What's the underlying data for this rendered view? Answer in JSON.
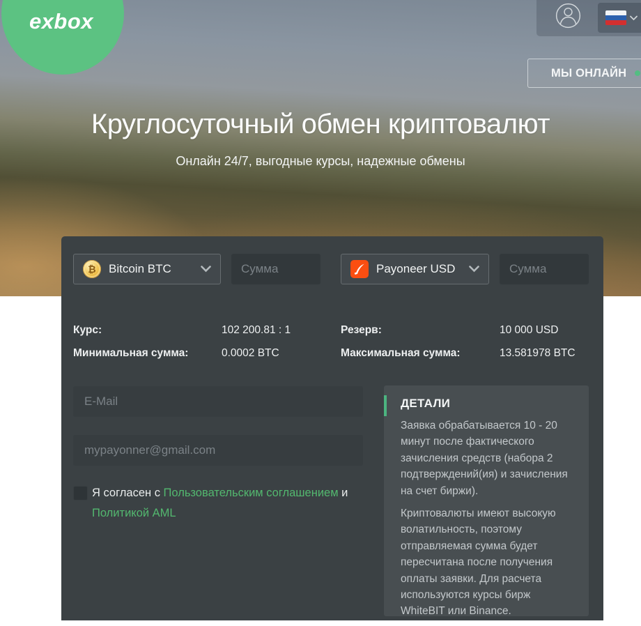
{
  "brand": {
    "logo": "exbox"
  },
  "header": {
    "online_label": "МЫ ОНЛАЙН"
  },
  "hero": {
    "title": "Круглосуточный обмен криптовалют",
    "subtitle": "Онлайн 24/7, выгодные курсы, надежные обмены"
  },
  "exchange": {
    "from": {
      "currency": "Bitcoin BTC",
      "amount_placeholder": "Сумма"
    },
    "to": {
      "currency": "Payoneer USD",
      "amount_placeholder": "Сумма"
    },
    "info": {
      "rate": {
        "label": "Курс:",
        "value": "102 200.81 : 1"
      },
      "reserve": {
        "label": "Резерв:",
        "value": "10 000 USD"
      },
      "min": {
        "label": "Минимальная сумма:",
        "value": "0.0002 BTC"
      },
      "max": {
        "label": "Максимальная сумма:",
        "value": "13.581978 BTC"
      }
    },
    "email_placeholder": "E-Mail",
    "wallet_placeholder": "mypayonner@gmail.com",
    "agreement": {
      "prefix": "Я согласен с ",
      "link_terms": "Пользовательским соглашением",
      "conjunction": " и ",
      "link_aml": "Политикой AML"
    }
  },
  "details": {
    "title": "ДЕТАЛИ",
    "paragraphs": {
      "p1": "Заявка обрабатывается 10 - 20 минут после фактического зачисления средств (набора 2 подтверждений(ия) и зачисления на счет биржи).",
      "p2": "Криптовалюты имеют высокую волатильность, поэтому отправляемая сумма будет пересчитана после получения оплаты заявки. Для расчета используются курсы бирж WhiteBIT или Binance."
    }
  },
  "colors": {
    "brand_green": "#5cc282",
    "link_green": "#53b86f",
    "accent_green": "#4cb480",
    "online_dot_green": "#54bd82",
    "payoneer_orange": "#fb4e11",
    "bitcoin_gold": "#e8b13d"
  }
}
